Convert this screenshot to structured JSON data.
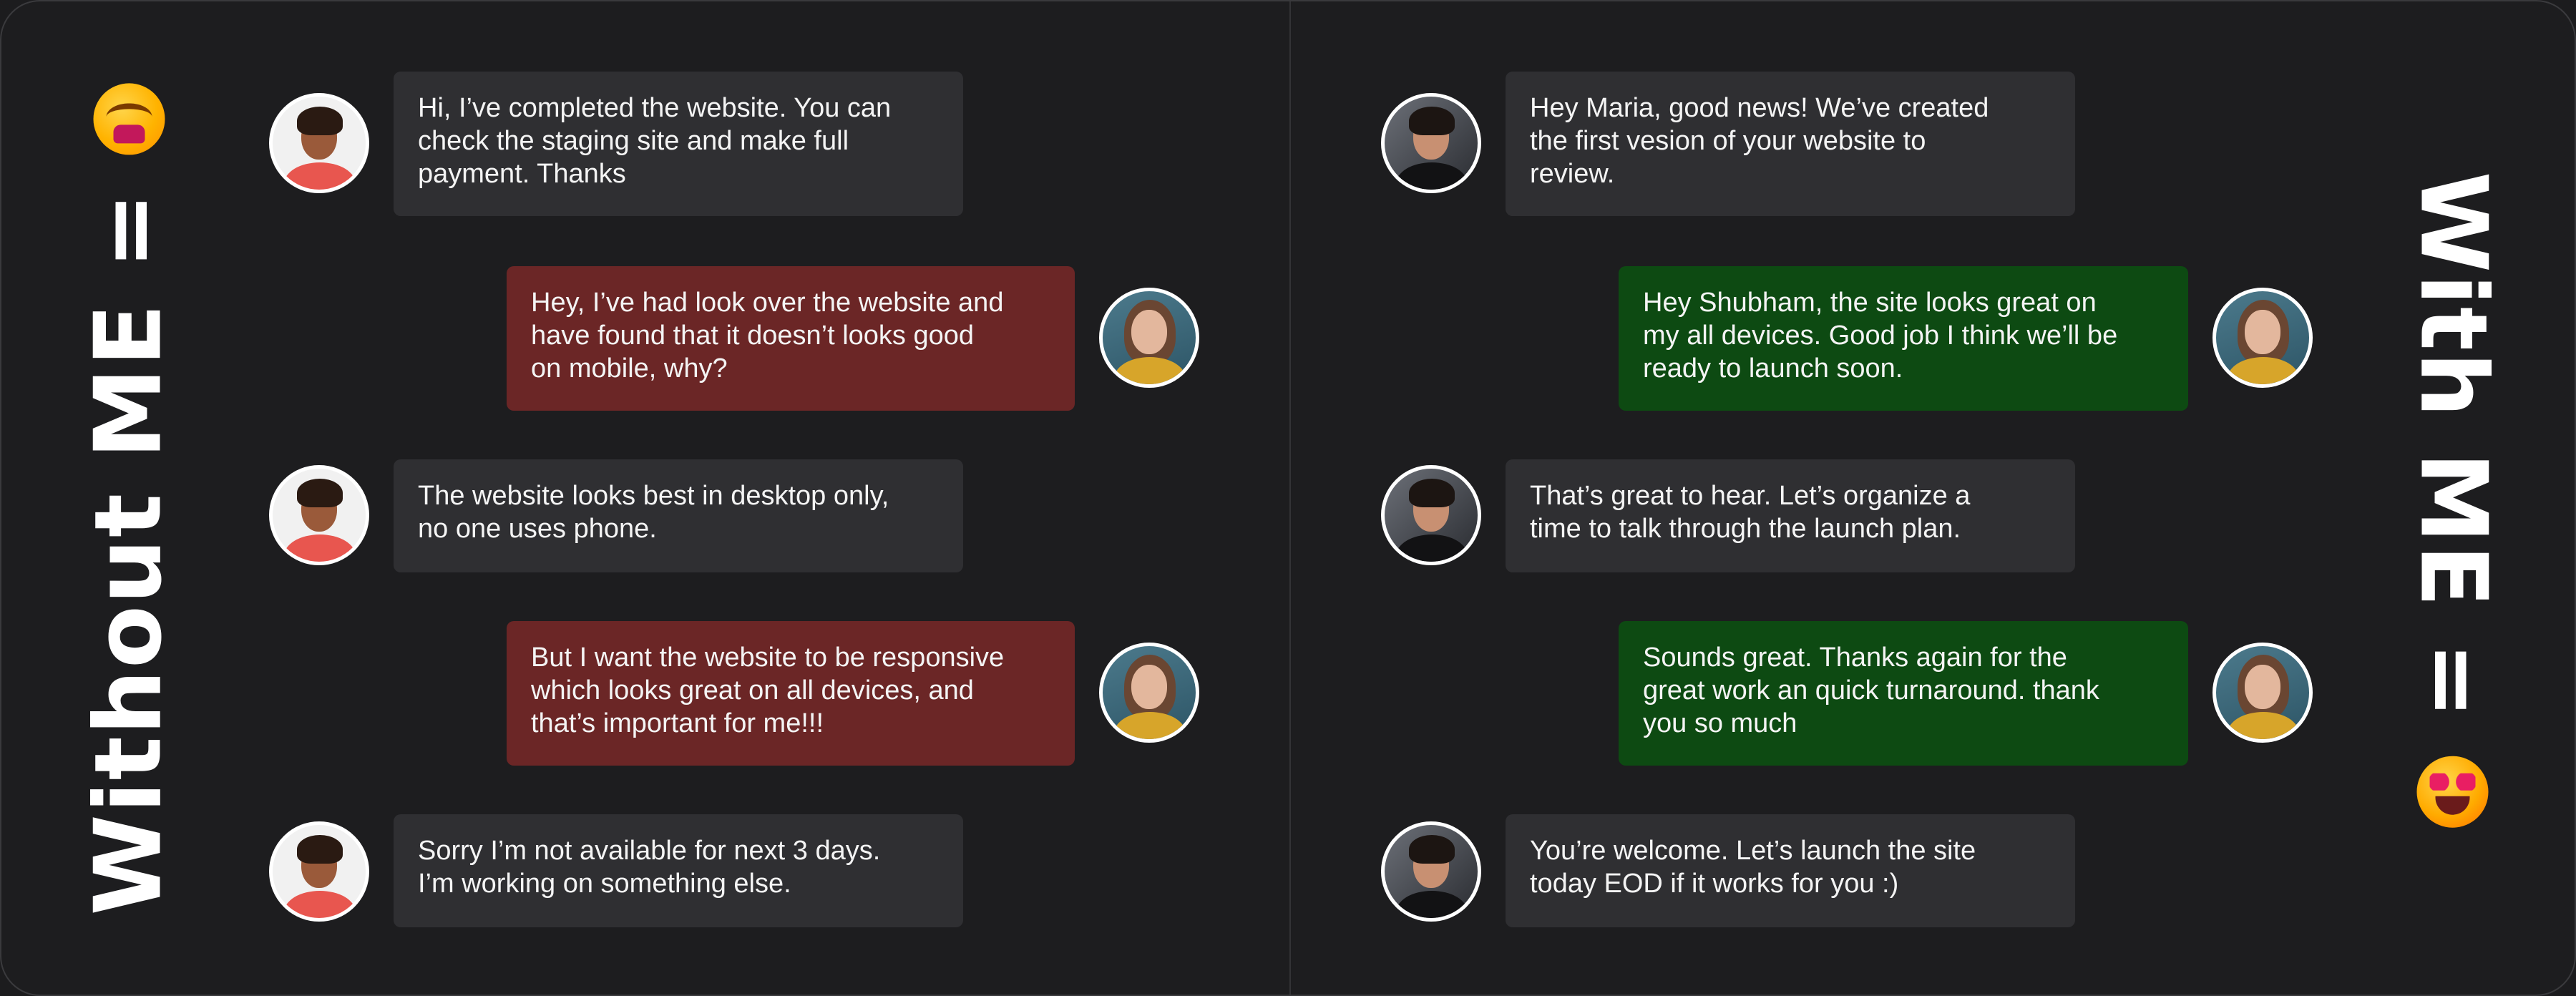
{
  "left_panel": {
    "title": "Without ME =",
    "emoji_icon": "cold-sweat-sad-emoji",
    "messages": [
      {
        "sender": "shubham",
        "text": "Hi, I’ve completed the website. You can\ncheck the staging site and make full\npayment. Thanks"
      },
      {
        "sender": "maria",
        "text": "Hey, I’ve had look over the website and\nhave found that it doesn’t looks good\non mobile, why?"
      },
      {
        "sender": "shubham",
        "text": "The website looks best in desktop only,\nno one uses phone."
      },
      {
        "sender": "maria",
        "text": "But I want the website to be responsive\nwhich looks great on all devices, and\nthat’s important for me!!!"
      },
      {
        "sender": "shubham",
        "text": "Sorry I’m not available for next 3 days.\nI’m working on something else."
      }
    ]
  },
  "right_panel": {
    "title": "With ME =",
    "emoji_icon": "heart-eyes-happy-emoji",
    "messages": [
      {
        "sender": "shubham",
        "text": "Hey Maria, good news! We’ve created\nthe first vesion of your website to\nreview."
      },
      {
        "sender": "maria",
        "text": "Hey Shubham, the site looks great on\nmy all devices. Good job I think we’ll be\nready to launch soon."
      },
      {
        "sender": "shubham",
        "text": "That’s great to hear. Let’s organize a\ntime to talk through the launch plan."
      },
      {
        "sender": "maria",
        "text": "Sounds great. Thanks again for the\ngreat work an quick turnaround. thank\nyou so much"
      },
      {
        "sender": "shubham",
        "text": "You’re welcome. Let’s launch the site\ntoday EOD if it works for you :)"
      }
    ]
  },
  "colors": {
    "background": "#1d1d1f",
    "bubble_neutral": "#2f2f32",
    "bubble_negative": "#6b2626",
    "bubble_positive": "#0d4a12"
  }
}
